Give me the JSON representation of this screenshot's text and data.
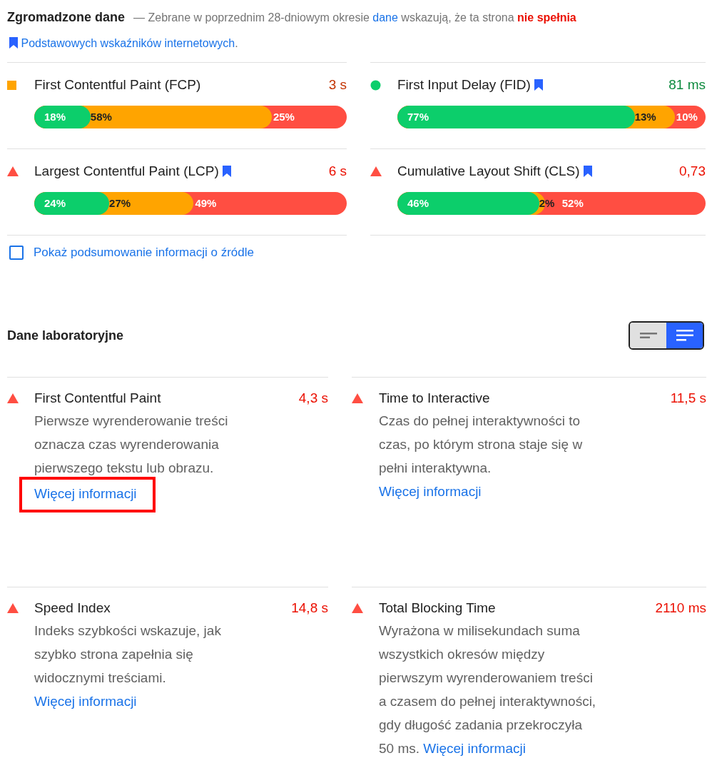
{
  "field_data": {
    "title": "Zgromadzone dane",
    "description": [
      {
        "kind": "text",
        "text": "— Zebrane w poprzednim 28-dniowym okresie "
      },
      {
        "kind": "link",
        "text": "dane"
      },
      {
        "kind": "text",
        "text": " wskazują, że ta strona "
      },
      {
        "kind": "fail",
        "text": "nie spełnia"
      },
      {
        "kind": "bookmark_link",
        "text": "Podstawowych wskaźników internetowych"
      },
      {
        "kind": "text",
        "text": "."
      }
    ],
    "metrics": [
      {
        "name": "First Contentful Paint (FCP)",
        "kind": "average",
        "bookmark": false,
        "value": "3 s",
        "good_share": {
          "level": 0.18
        },
        "good_or_average_share": {
          "level": 0.76
        },
        "labels": [
          "18%",
          "58%",
          "25%"
        ]
      },
      {
        "name": "First Input Delay (FID)",
        "kind": "good",
        "bookmark": true,
        "value": "81 ms",
        "good_share": {
          "level": 0.77
        },
        "good_or_average_share": {
          "level": 0.9
        },
        "labels": [
          "77%",
          "13%",
          "10%"
        ]
      },
      {
        "name": "Largest Contentful Paint (LCP)",
        "kind": "poor",
        "bookmark": true,
        "value": "6 s",
        "good_share": {
          "level": 0.24
        },
        "good_or_average_share": {
          "level": 0.51
        },
        "labels": [
          "24%",
          "27%",
          "49%"
        ]
      },
      {
        "name": "Cumulative Layout Shift (CLS)",
        "kind": "poor",
        "bookmark": true,
        "value": "0,73",
        "good_share": {
          "level": 0.46
        },
        "good_or_average_share": {
          "level": 0.48
        },
        "labels": [
          "46%",
          "2%",
          "52%"
        ]
      }
    ],
    "source_summary": {
      "label": "Pokaż podsumowanie informacji o źródle",
      "checked": false
    }
  },
  "lab_data": {
    "title": "Dane laboratoryjne",
    "view_toggle": [
      {
        "kind": "short",
        "selected": false
      },
      {
        "kind": "full",
        "selected": true
      }
    ],
    "metrics": [
      {
        "name": "First Contentful Paint",
        "kind": "poor",
        "value": "4,3 s",
        "description": "Pierwsze wyrenderowanie treści oznacza czas wyrenderowania pierwszego tekstu lub obrazu.",
        "link": "Więcej informacji",
        "highlighted": true
      },
      {
        "name": "Time to Interactive",
        "kind": "poor",
        "value": "11,5 s",
        "description": "Czas do pełnej interaktywności to czas, po którym strona staje się w pełni interaktywna.",
        "link": "Więcej informacji",
        "highlighted": false
      },
      {
        "name": "Speed Index",
        "kind": "poor",
        "value": "14,8 s",
        "description": "Indeks szybkości wskazuje, jak szybko strona zapełnia się widocznymi treściami.",
        "link": "Więcej informacji",
        "highlighted": false
      },
      {
        "name": "Total Blocking Time",
        "kind": "poor",
        "value": "2110 ms",
        "description": "Wyrażona w milisekundach suma wszystkich okresów między pierwszym wyrenderowaniem treści a czasem do pełnej interaktywności, gdy długość zadania przekroczyła 50 ms.",
        "link": "Więcej informacji",
        "highlighted": false
      }
    ]
  }
}
